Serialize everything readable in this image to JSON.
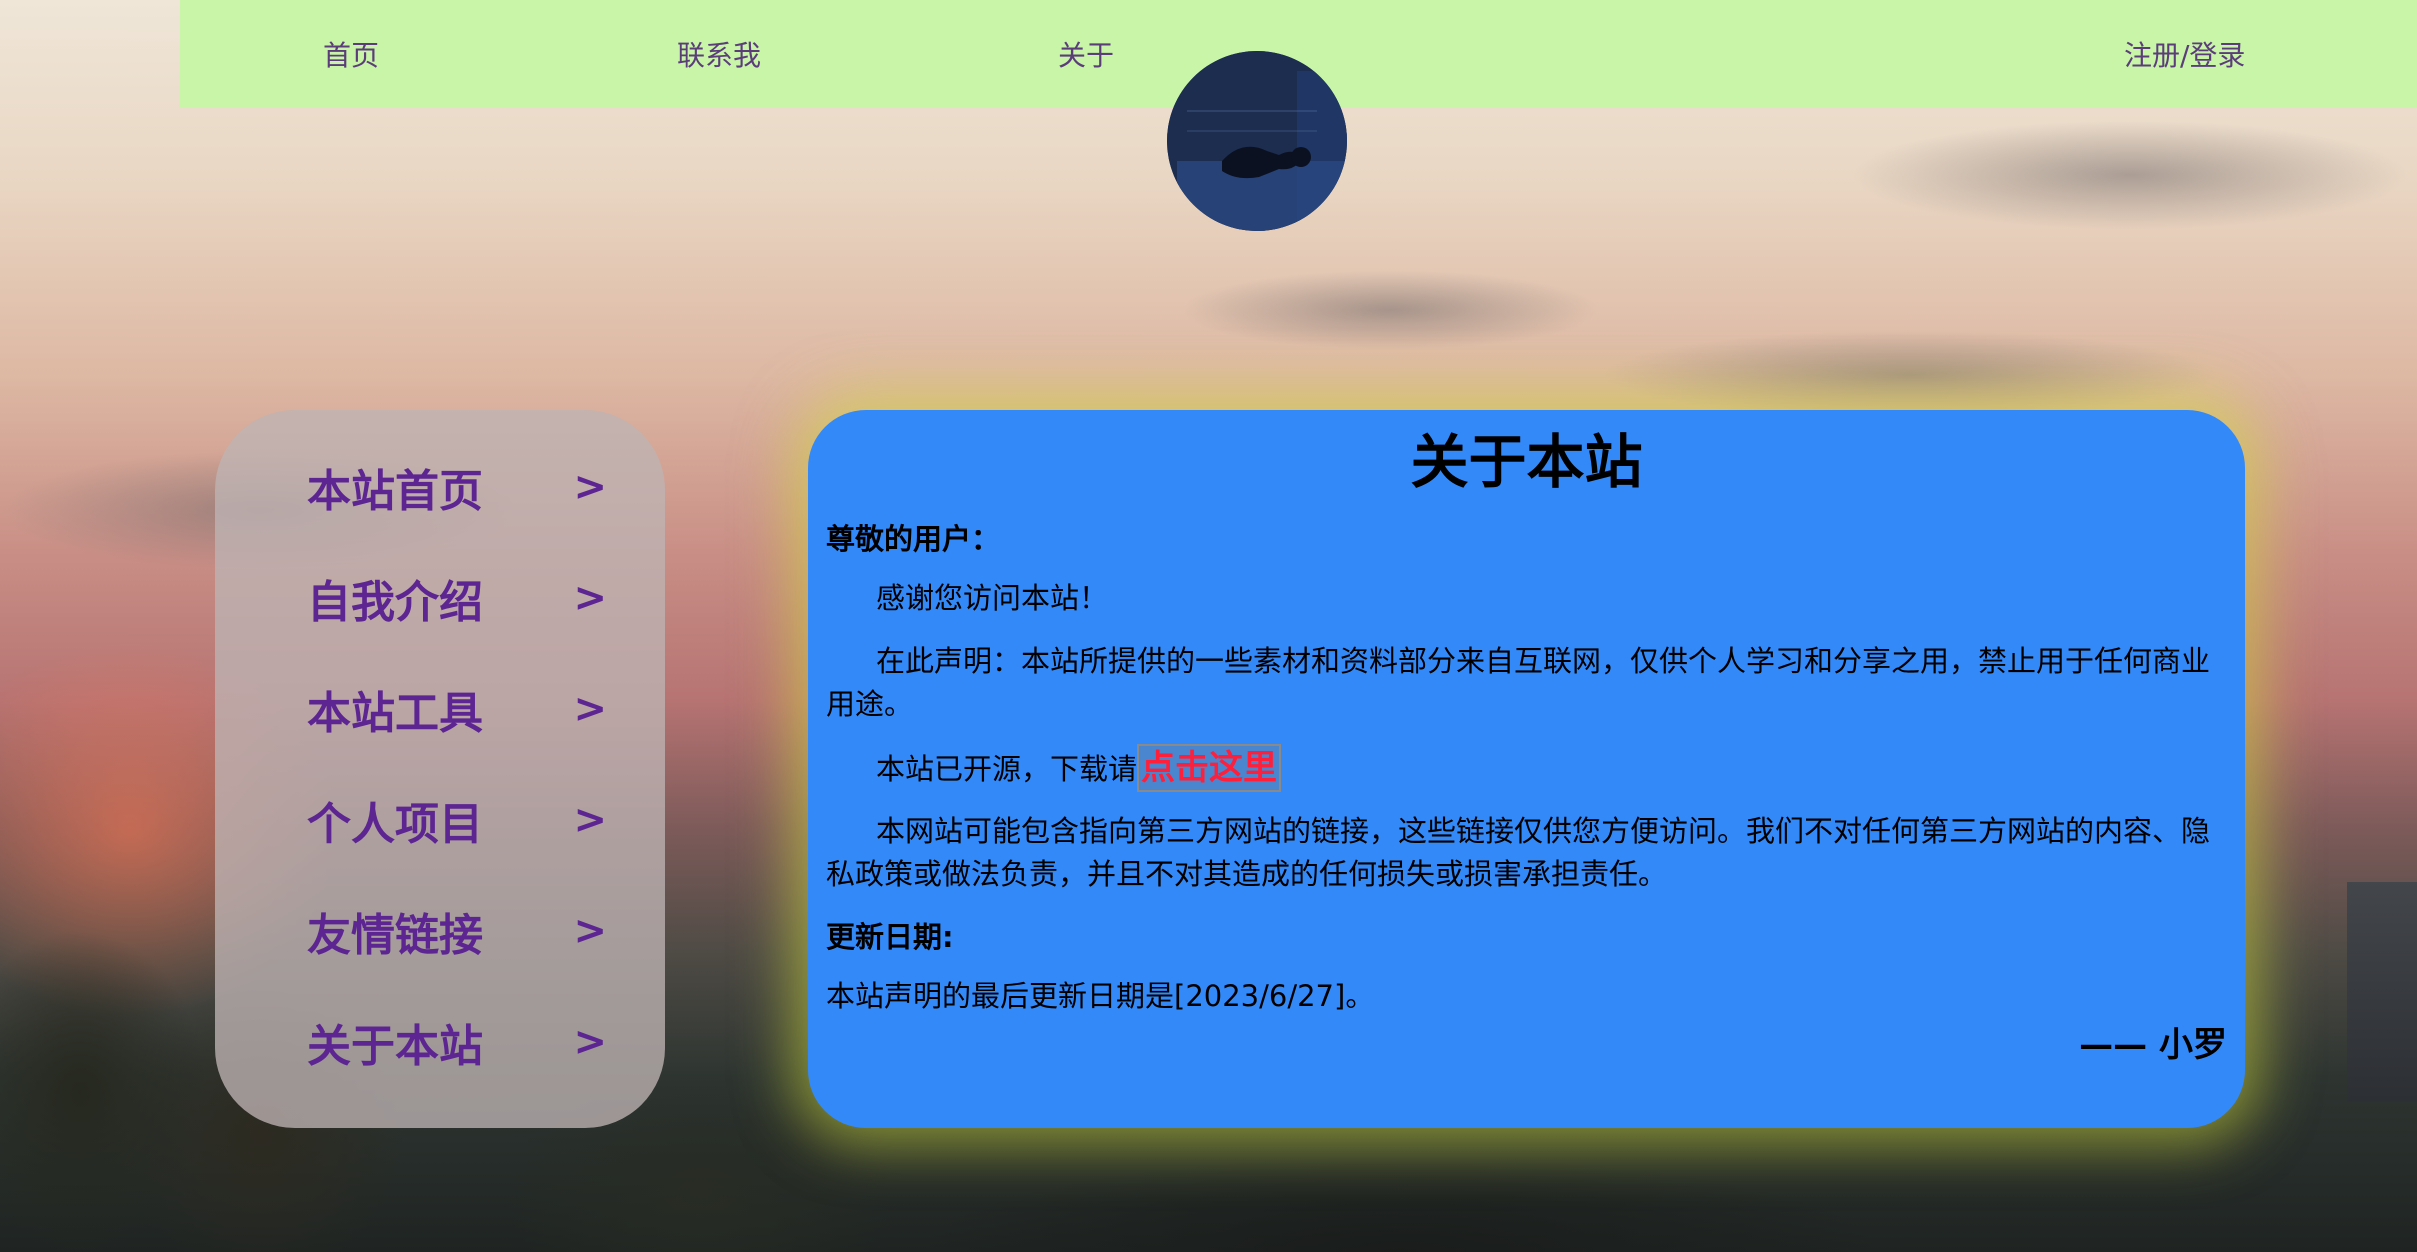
{
  "nav": {
    "home": "首页",
    "contact": "联系我",
    "about": "关于",
    "login": "注册/登录"
  },
  "sidebar": {
    "items": [
      {
        "label": "本站首页",
        "arrow": ">"
      },
      {
        "label": "自我介绍",
        "arrow": ">"
      },
      {
        "label": "本站工具",
        "arrow": ">"
      },
      {
        "label": "个人项目",
        "arrow": ">"
      },
      {
        "label": "友情链接",
        "arrow": ">"
      },
      {
        "label": "关于本站",
        "arrow": ">"
      }
    ]
  },
  "content": {
    "title": "关于本站",
    "greeting": "尊敬的用户：",
    "thanks": "感谢您访问本站！",
    "disclaimer": "在此声明：本站所提供的一些素材和资料部分来自互联网，仅供个人学习和分享之用，禁止用于任何商业用途。",
    "opensource_prefix": "本站已开源，下载请",
    "download_link": "点击这里",
    "third_party": "本网站可能包含指向第三方网站的链接，这些链接仅供您方便访问。我们不对任何第三方网站的内容、隐私政策或做法负责，并且不对其造成的任何损失或损害承担责任。",
    "update_heading": "更新日期:",
    "update_text": "本站声明的最后更新日期是[2023/6/27]。",
    "signature": "—— 小罗"
  },
  "colors": {
    "topbar_bg": "#c8f5a8",
    "nav_text": "#5b3d7a",
    "menu_text": "#5d2591",
    "card_bg": "#3489f9",
    "link_red": "#ff1f3a"
  },
  "icons": {
    "avatar": "user-avatar-photo"
  }
}
